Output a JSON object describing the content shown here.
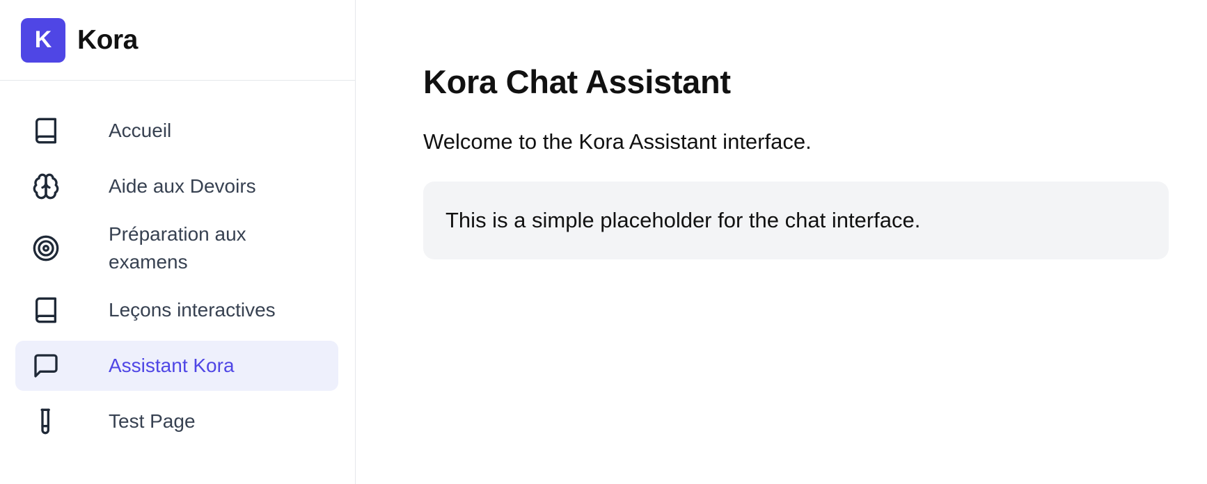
{
  "brand": {
    "logo_letter": "K",
    "name": "Kora",
    "accent_color": "#4f46e5"
  },
  "sidebar": {
    "items": [
      {
        "label": "Accueil",
        "icon": "book-icon",
        "active": false
      },
      {
        "label": "Aide aux Devoirs",
        "icon": "brain-icon",
        "active": false
      },
      {
        "label": "Préparation aux examens",
        "icon": "target-icon",
        "active": false
      },
      {
        "label": "Leçons interactives",
        "icon": "book-icon",
        "active": false
      },
      {
        "label": "Assistant Kora",
        "icon": "message-square-icon",
        "active": true
      },
      {
        "label": "Test Page",
        "icon": "test-tube-icon",
        "active": false
      }
    ]
  },
  "main": {
    "title": "Kora Chat Assistant",
    "subtitle": "Welcome to the Kora Assistant interface.",
    "placeholder_text": "This is a simple placeholder for the chat interface."
  }
}
